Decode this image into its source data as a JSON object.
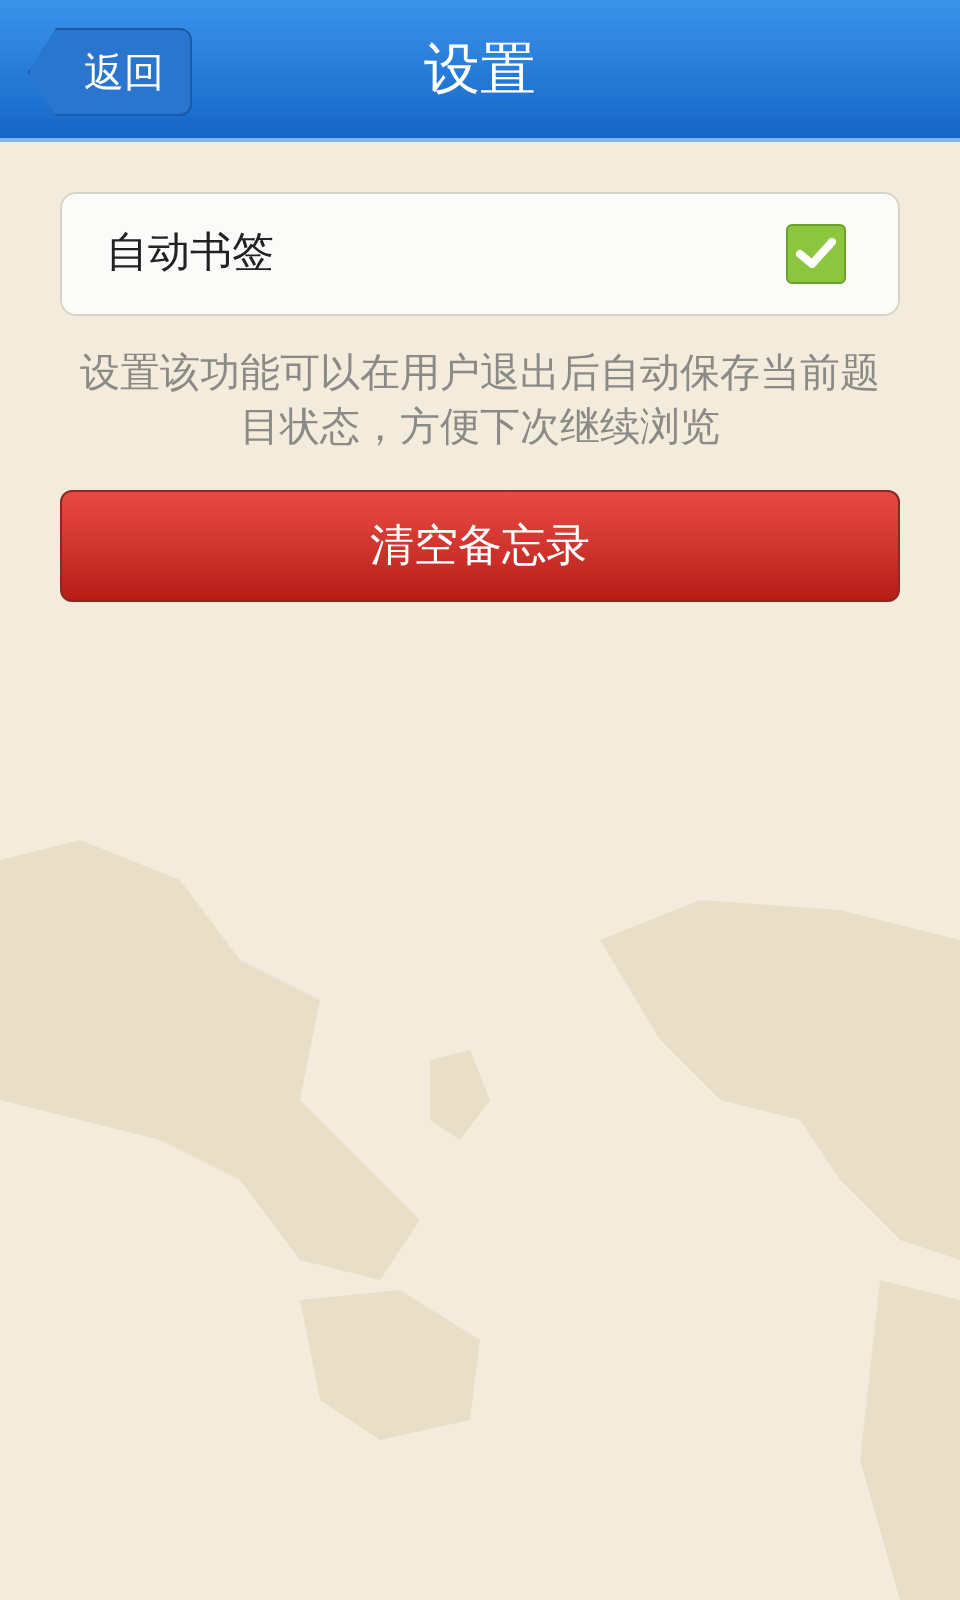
{
  "header": {
    "title": "设置",
    "back_button": "返回"
  },
  "settings": [
    {
      "label": "自动书签",
      "checked": true
    }
  ],
  "hint": "设置该功能可以在用户退出后自动保存当前题目状态，方便下次继续浏览",
  "clear_button": "清空备忘录"
}
